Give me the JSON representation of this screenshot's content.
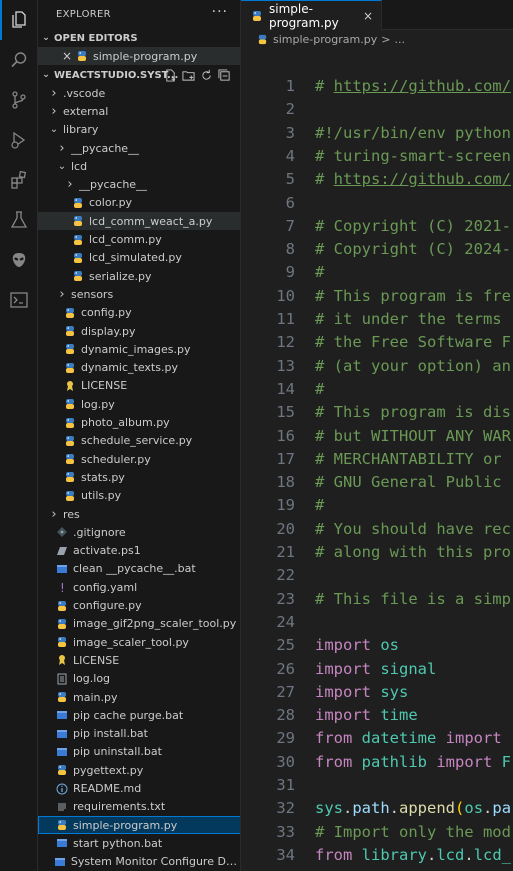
{
  "activity_bar": {
    "icons": [
      "files-icon",
      "search-icon",
      "source-control-icon",
      "run-debug-icon",
      "extensions-icon",
      "testing-icon",
      "alien-icon",
      "terminal-icon"
    ]
  },
  "sidebar": {
    "title": "EXPLORER",
    "more": "···",
    "open_editors": {
      "header": "OPEN EDITORS",
      "items": [
        {
          "close": "×",
          "label": "simple-program.py"
        }
      ]
    },
    "project": {
      "header": "WEACTSTUDIO.SYST..."
    },
    "tree": [
      {
        "label": ".vscode",
        "type": "folder",
        "depth": 1,
        "collapsed": true
      },
      {
        "label": "external",
        "type": "folder",
        "depth": 1,
        "collapsed": true
      },
      {
        "label": "library",
        "type": "folder",
        "depth": 1,
        "collapsed": false
      },
      {
        "label": "__pycache__",
        "type": "folder",
        "depth": 2,
        "collapsed": true
      },
      {
        "label": "lcd",
        "type": "folder",
        "depth": 2,
        "collapsed": false
      },
      {
        "label": "__pycache__",
        "type": "folder",
        "depth": 3,
        "collapsed": true
      },
      {
        "label": "color.py",
        "type": "py",
        "depth": 3
      },
      {
        "label": "lcd_comm_weact_a.py",
        "type": "py",
        "depth": 3,
        "hover": true
      },
      {
        "label": "lcd_comm.py",
        "type": "py",
        "depth": 3
      },
      {
        "label": "lcd_simulated.py",
        "type": "py",
        "depth": 3
      },
      {
        "label": "serialize.py",
        "type": "py",
        "depth": 3
      },
      {
        "label": "sensors",
        "type": "folder",
        "depth": 2,
        "collapsed": true
      },
      {
        "label": "config.py",
        "type": "py",
        "depth": 2
      },
      {
        "label": "display.py",
        "type": "py",
        "depth": 2
      },
      {
        "label": "dynamic_images.py",
        "type": "py",
        "depth": 2
      },
      {
        "label": "dynamic_texts.py",
        "type": "py",
        "depth": 2
      },
      {
        "label": "LICENSE",
        "type": "license",
        "depth": 2
      },
      {
        "label": "log.py",
        "type": "py",
        "depth": 2
      },
      {
        "label": "photo_album.py",
        "type": "py",
        "depth": 2
      },
      {
        "label": "schedule_service.py",
        "type": "py",
        "depth": 2
      },
      {
        "label": "scheduler.py",
        "type": "py",
        "depth": 2
      },
      {
        "label": "stats.py",
        "type": "py",
        "depth": 2
      },
      {
        "label": "utils.py",
        "type": "py",
        "depth": 2
      },
      {
        "label": "res",
        "type": "folder",
        "depth": 1,
        "collapsed": true
      },
      {
        "label": ".gitignore",
        "type": "git",
        "depth": 1
      },
      {
        "label": "activate.ps1",
        "type": "ps",
        "depth": 1
      },
      {
        "label": "clean __pycache__.bat",
        "type": "bat",
        "depth": 1
      },
      {
        "label": "config.yaml",
        "type": "yaml",
        "depth": 1
      },
      {
        "label": "configure.py",
        "type": "py",
        "depth": 1
      },
      {
        "label": "image_gif2png_scaler_tool.py",
        "type": "py",
        "depth": 1
      },
      {
        "label": "image_scaler_tool.py",
        "type": "py",
        "depth": 1
      },
      {
        "label": "LICENSE",
        "type": "license",
        "depth": 1
      },
      {
        "label": "log.log",
        "type": "log",
        "depth": 1
      },
      {
        "label": "main.py",
        "type": "py",
        "depth": 1
      },
      {
        "label": "pip cache purge.bat",
        "type": "bat",
        "depth": 1
      },
      {
        "label": "pip install.bat",
        "type": "bat",
        "depth": 1
      },
      {
        "label": "pip uninstall.bat",
        "type": "bat",
        "depth": 1
      },
      {
        "label": "pygettext.py",
        "type": "py",
        "depth": 1
      },
      {
        "label": "README.md",
        "type": "info",
        "depth": 1
      },
      {
        "label": "requirements.txt",
        "type": "txt",
        "depth": 1
      },
      {
        "label": "simple-program.py",
        "type": "py",
        "depth": 1,
        "selected": true
      },
      {
        "label": "start python.bat",
        "type": "bat",
        "depth": 1
      },
      {
        "label": "System Monitor Configure Debug...",
        "type": "bat",
        "depth": 1
      }
    ]
  },
  "editor": {
    "tab": {
      "label": "simple-program.py",
      "close": "×"
    },
    "breadcrumb": {
      "file": "simple-program.py",
      "sep": ">",
      "rest": "..."
    },
    "lines": [
      [
        [
          "# ",
          "cmt"
        ],
        [
          "https://github.com/",
          "link"
        ]
      ],
      [],
      [
        [
          "#!/usr/bin/env python",
          "cmt"
        ]
      ],
      [
        [
          "# turing-smart-screen",
          "cmt"
        ]
      ],
      [
        [
          "# ",
          "cmt"
        ],
        [
          "https://github.com/",
          "link"
        ]
      ],
      [],
      [
        [
          "# Copyright (C) 2021-",
          "cmt"
        ]
      ],
      [
        [
          "# Copyright (C) 2024-",
          "cmt"
        ]
      ],
      [
        [
          "#",
          "cmt"
        ]
      ],
      [
        [
          "# This program is fre",
          "cmt"
        ]
      ],
      [
        [
          "# it under the terms ",
          "cmt"
        ]
      ],
      [
        [
          "# the Free Software F",
          "cmt"
        ]
      ],
      [
        [
          "# (at your option) an",
          "cmt"
        ]
      ],
      [
        [
          "#",
          "cmt"
        ]
      ],
      [
        [
          "# This program is dis",
          "cmt"
        ]
      ],
      [
        [
          "# but WITHOUT ANY WAR",
          "cmt"
        ]
      ],
      [
        [
          "# MERCHANTABILITY or ",
          "cmt"
        ]
      ],
      [
        [
          "# GNU General Public ",
          "cmt"
        ]
      ],
      [
        [
          "#",
          "cmt"
        ]
      ],
      [
        [
          "# You should have rec",
          "cmt"
        ]
      ],
      [
        [
          "# along with this pro",
          "cmt"
        ]
      ],
      [],
      [
        [
          "# This file is a simp",
          "cmt"
        ]
      ],
      [],
      [
        [
          "import",
          "kw"
        ],
        [
          " ",
          "pl"
        ],
        [
          "os",
          "mod"
        ]
      ],
      [
        [
          "import",
          "kw"
        ],
        [
          " ",
          "pl"
        ],
        [
          "signal",
          "mod"
        ]
      ],
      [
        [
          "import",
          "kw"
        ],
        [
          " ",
          "pl"
        ],
        [
          "sys",
          "mod"
        ]
      ],
      [
        [
          "import",
          "kw"
        ],
        [
          " ",
          "pl"
        ],
        [
          "time",
          "mod"
        ]
      ],
      [
        [
          "from",
          "kw"
        ],
        [
          " ",
          "pl"
        ],
        [
          "datetime",
          "mod"
        ],
        [
          " ",
          "pl"
        ],
        [
          "import",
          "kw"
        ],
        [
          " ",
          "pl"
        ]
      ],
      [
        [
          "from",
          "kw"
        ],
        [
          " ",
          "pl"
        ],
        [
          "pathlib",
          "mod"
        ],
        [
          " ",
          "pl"
        ],
        [
          "import",
          "kw"
        ],
        [
          " F",
          "mod"
        ]
      ],
      [],
      [
        [
          "sys",
          "mod"
        ],
        [
          ".",
          "pl"
        ],
        [
          "path",
          "var"
        ],
        [
          ".",
          "pl"
        ],
        [
          "append",
          "fn"
        ],
        [
          "(",
          "brk"
        ],
        [
          "os",
          "mod"
        ],
        [
          ".",
          "pl"
        ],
        [
          "pa",
          "var"
        ]
      ],
      [
        [
          "# Import only the mod",
          "cmt"
        ]
      ],
      [
        [
          "from",
          "kw"
        ],
        [
          " ",
          "pl"
        ],
        [
          "library",
          "mod"
        ],
        [
          ".",
          "pl"
        ],
        [
          "lcd",
          "mod"
        ],
        [
          ".",
          "pl"
        ],
        [
          "lcd_",
          "mod"
        ]
      ]
    ]
  },
  "colors": {
    "accent": "#0078d4",
    "selection_bg": "#04395e",
    "comment": "#6a9955",
    "keyword": "#c586c0",
    "module": "#4ec9b0",
    "line_number": "#6e7681"
  }
}
